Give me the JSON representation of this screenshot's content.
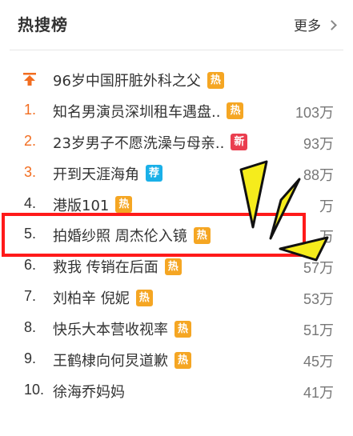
{
  "header": {
    "title": "热搜榜",
    "more_label": "更多"
  },
  "icons": {
    "pinned": "pin-to-top-icon",
    "more": "chevron-right-icon"
  },
  "colors": {
    "hot": "#f5a623",
    "new": "#ea3e4f",
    "recommend": "#1ab0e8",
    "top_rank": "#f26d20",
    "highlight": "#ff1a1a",
    "arrows": "#f5ec1c"
  },
  "pinned": {
    "text": "96岁中国肝脏外科之父",
    "badge": "热",
    "badge_type": "hot"
  },
  "items": [
    {
      "rank": "1.",
      "text": "知名男演员深圳租车遇盘..",
      "badge": "热",
      "badge_type": "hot",
      "count": "103万"
    },
    {
      "rank": "2.",
      "text": "23岁男子不愿洗澡与母亲..",
      "badge": "新",
      "badge_type": "new",
      "count": "93万"
    },
    {
      "rank": "3.",
      "text": "开到天涯海角",
      "badge": "荐",
      "badge_type": "recommend",
      "count": "88万"
    },
    {
      "rank": "4.",
      "text": "港版101",
      "badge": "热",
      "badge_type": "hot",
      "count": "万"
    },
    {
      "rank": "5.",
      "text": "拍婚纱照 周杰伦入镜",
      "badge": "热",
      "badge_type": "hot",
      "count": "万"
    },
    {
      "rank": "6.",
      "text": "救我 传销在后面",
      "badge": "热",
      "badge_type": "hot",
      "count": "57万"
    },
    {
      "rank": "7.",
      "text": "刘柏辛 倪妮",
      "badge": "热",
      "badge_type": "hot",
      "count": "53万"
    },
    {
      "rank": "8.",
      "text": "快乐大本营收视率",
      "badge": "热",
      "badge_type": "hot",
      "count": "51万"
    },
    {
      "rank": "9.",
      "text": "王鹤棣向何炅道歉",
      "badge": "热",
      "badge_type": "hot",
      "count": "45万"
    },
    {
      "rank": "10.",
      "text": "徐海乔妈妈",
      "badge": "",
      "badge_type": "",
      "count": "41万"
    }
  ]
}
